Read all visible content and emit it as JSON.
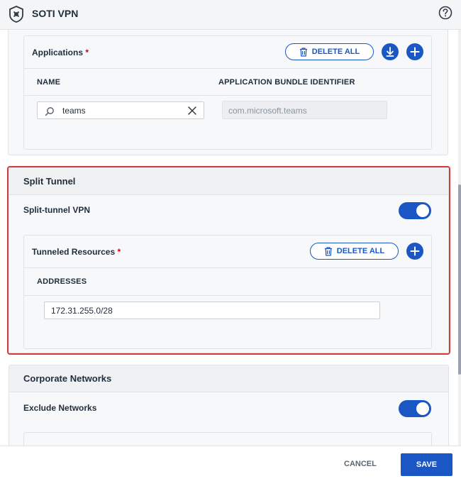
{
  "header": {
    "title": "SOTI VPN"
  },
  "applications": {
    "label": "Applications",
    "required_mark": "*",
    "delete_all_label": "DELETE ALL",
    "columns": [
      "NAME",
      "APPLICATION BUNDLE IDENTIFIER"
    ],
    "search_value": "teams",
    "bundle_identifier": "com.microsoft.teams"
  },
  "split_tunnel": {
    "title": "Split Tunnel",
    "vpn_label": "Split-tunnel VPN",
    "vpn_enabled": true,
    "resources_label": "Tunneled Resources",
    "required_mark": "*",
    "delete_all_label": "DELETE ALL",
    "addresses_header": "ADDRESSES",
    "address_value": "172.31.255.0/28"
  },
  "corporate_networks": {
    "title": "Corporate Networks",
    "exclude_label": "Exclude Networks",
    "exclude_enabled": true
  },
  "footer": {
    "cancel_label": "CANCEL",
    "save_label": "SAVE"
  },
  "colors": {
    "accent": "#1a56c4",
    "highlight": "#d33b3b",
    "required": "#d0021b"
  }
}
